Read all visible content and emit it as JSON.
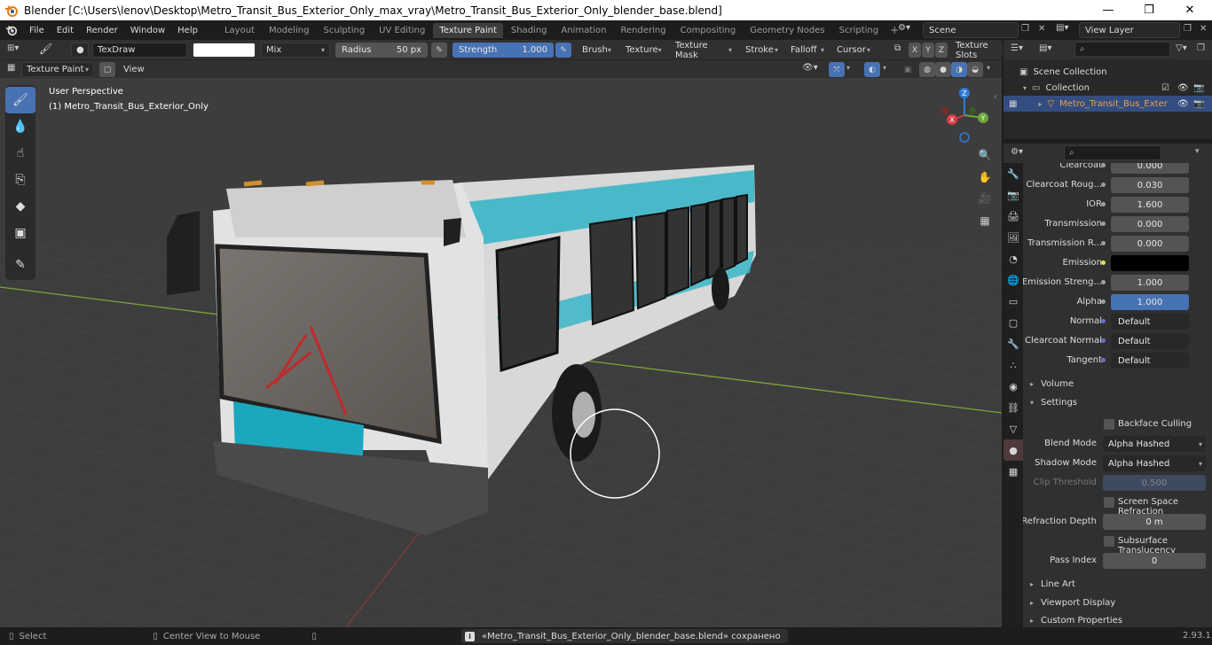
{
  "window": {
    "title": "Blender [C:\\Users\\lenov\\Desktop\\Metro_Transit_Bus_Exterior_Only_max_vray\\Metro_Transit_Bus_Exterior_Only_blender_base.blend]",
    "minimize": "—",
    "maximize": "❐",
    "close": "✕"
  },
  "menu": [
    "File",
    "Edit",
    "Render",
    "Window",
    "Help"
  ],
  "workspaces": [
    "Layout",
    "Modeling",
    "Sculpting",
    "UV Editing",
    "Texture Paint",
    "Shading",
    "Animation",
    "Rendering",
    "Compositing",
    "Geometry Nodes",
    "Scripting"
  ],
  "active_workspace": "Texture Paint",
  "scene": "Scene",
  "view_layer": "View Layer",
  "tool_header": {
    "brush_name": "TexDraw",
    "blend": "Mix",
    "radius_label": "Radius",
    "radius_value": "50 px",
    "strength_label": "Strength",
    "strength_value": "1.000",
    "menus": [
      "Brush",
      "Texture",
      "Texture Mask",
      "Stroke",
      "Falloff",
      "Cursor"
    ],
    "axes": [
      "X",
      "Y",
      "Z"
    ],
    "texture_slots": "Texture Slots"
  },
  "viewport_header": {
    "mode": "Texture Paint",
    "view": "View"
  },
  "viewport": {
    "perspective": "User Perspective",
    "object_name": "(1) Metro_Transit_Bus_Exterior_Only",
    "gizmo": {
      "x": "X",
      "y": "Y",
      "z": "Z"
    }
  },
  "outliner": {
    "scene_collection": "Scene Collection",
    "collection": "Collection",
    "object": "Metro_Transit_Bus_Exter"
  },
  "properties": {
    "rows": [
      {
        "label": "Clearcoat",
        "value": "0.000"
      },
      {
        "label": "Clearcoat Roug...",
        "value": "0.030"
      },
      {
        "label": "IOR",
        "value": "1.600"
      },
      {
        "label": "Transmission",
        "value": "0.000"
      },
      {
        "label": "Transmission R...",
        "value": "0.000"
      },
      {
        "label": "Emission",
        "value": ""
      },
      {
        "label": "Emission Streng...",
        "value": "1.000"
      },
      {
        "label": "Alpha",
        "value": "1.000"
      },
      {
        "label": "Normal",
        "value": "Default"
      },
      {
        "label": "Clearcoat Normal",
        "value": "Default"
      },
      {
        "label": "Tangent",
        "value": "Default"
      }
    ],
    "volume": "Volume",
    "settings": "Settings",
    "backface_culling": "Backface Culling",
    "blend_mode_label": "Blend Mode",
    "blend_mode": "Alpha Hashed",
    "shadow_mode_label": "Shadow Mode",
    "shadow_mode": "Alpha Hashed",
    "clip_threshold_label": "Clip Threshold",
    "clip_threshold": "0.500",
    "screen_space_refraction": "Screen Space Refraction",
    "refraction_depth_label": "Refraction Depth",
    "refraction_depth": "0 m",
    "subsurface_translucency": "Subsurface Translucency",
    "pass_index_label": "Pass Index",
    "pass_index": "0",
    "line_art": "Line Art",
    "viewport_display": "Viewport Display",
    "custom_properties": "Custom Properties"
  },
  "status": {
    "select": "Select",
    "center_view": "Center View to Mouse",
    "message": "«Metro_Transit_Bus_Exterior_Only_blender_base.blend» сохранено",
    "version": "2.93.1"
  },
  "colors": {
    "accent": "#4772b3",
    "bus_teal": "#1ba7bd",
    "bus_body": "#d8d8d8",
    "brush_cursor": "#ffffff"
  }
}
